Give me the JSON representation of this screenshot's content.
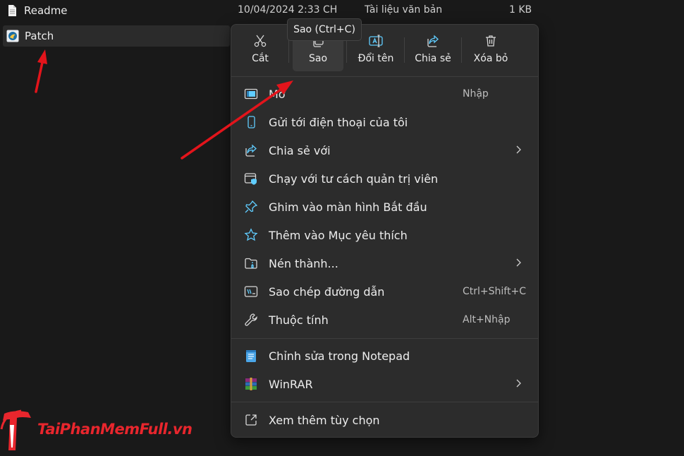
{
  "files": [
    {
      "name": "Readme",
      "date": "10/04/2024 2:33 CH",
      "type": "Tài liệu văn bản",
      "size": "1 KB",
      "icon": "text-document-icon"
    },
    {
      "name": "Patch",
      "icon": "patch-app-icon"
    }
  ],
  "tooltip": "Sao (Ctrl+C)",
  "toolbar": [
    {
      "label": "Cắt",
      "icon": "scissors-icon"
    },
    {
      "label": "Sao",
      "icon": "copy-icon"
    },
    {
      "label": "Đổi tên",
      "icon": "rename-icon"
    },
    {
      "label": "Chia sẻ",
      "icon": "share-icon"
    },
    {
      "label": "Xóa bỏ",
      "icon": "trash-icon"
    }
  ],
  "menu": [
    {
      "label": "Mở",
      "shortcut": "Nhập",
      "icon": "open-app-icon"
    },
    {
      "label": "Gửi tới điện thoại của tôi",
      "icon": "phone-icon"
    },
    {
      "label": "Chia sẻ với",
      "icon": "share-with-icon",
      "submenu": true
    },
    {
      "label": "Chạy với tư cách quản trị viên",
      "icon": "admin-shield-icon"
    },
    {
      "label": "Ghim vào màn hình Bắt đầu",
      "icon": "pin-icon"
    },
    {
      "label": "Thêm vào Mục yêu thích",
      "icon": "star-icon"
    },
    {
      "label": "Nén thành...",
      "icon": "zip-folder-icon",
      "submenu": true
    },
    {
      "label": "Sao chép đường dẫn",
      "shortcut": "Ctrl+Shift+C",
      "icon": "copy-path-icon"
    },
    {
      "label": "Thuộc tính",
      "shortcut": "Alt+Nhập",
      "icon": "wrench-icon"
    },
    {
      "label": "Chỉnh sửa trong Notepad",
      "icon": "notepad-icon"
    },
    {
      "label": "WinRAR",
      "icon": "winrar-icon",
      "submenu": true
    },
    {
      "label": "Xem thêm tùy chọn",
      "icon": "more-options-icon"
    }
  ],
  "watermark": "TaiPhanMemFull.vn",
  "colors": {
    "accent": "#60cdff",
    "annotation_arrow": "#e3141b",
    "menu_bg": "#2c2c2c",
    "page_bg": "#191919"
  }
}
